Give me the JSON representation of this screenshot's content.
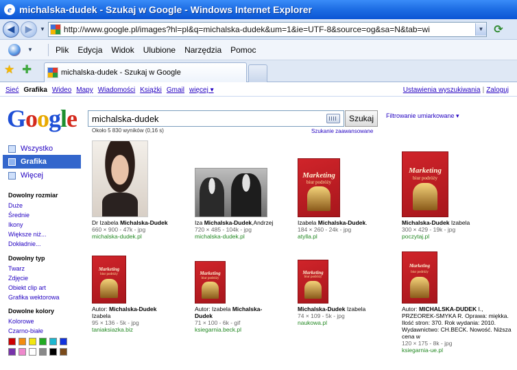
{
  "window": {
    "title": "michalska-dudek - Szukaj w Google - Windows Internet Explorer"
  },
  "address": {
    "url": "http://www.google.pl/images?hl=pl&q=michalska-dudek&um=1&ie=UTF-8&source=og&sa=N&tab=wi"
  },
  "menu": [
    "Plik",
    "Edycja",
    "Widok",
    "Ulubione",
    "Narzędzia",
    "Pomoc"
  ],
  "tab": {
    "label": "michalska-dudek - Szukaj w Google"
  },
  "gbar": {
    "links": [
      "Sieć",
      "Grafika",
      "Wideo",
      "Mapy",
      "Wiadomości",
      "Książki",
      "Gmail",
      "więcej ▾"
    ],
    "settings": "Ustawienia wyszukiwania",
    "separator": "|",
    "login": "Zaloguj"
  },
  "logo": {
    "letters": [
      "G",
      "o",
      "o",
      "g",
      "l",
      "e"
    ]
  },
  "search": {
    "query": "michalska-dudek",
    "button": "Szukaj",
    "safesearch": "Filtrowanie umiarkowane ▾",
    "results": "Około 5 830 wyników  (0,16 s)",
    "advanced": "Szukanie zaawansowane"
  },
  "sidebar": {
    "types": [
      "Wszystko",
      "Grafika",
      "Więcej"
    ],
    "size_head": "Dowolny rozmiar",
    "sizes": [
      "Duże",
      "Średnie",
      "Ikony",
      "Większe niż...",
      "Dokładnie..."
    ],
    "type_head": "Dowolny typ",
    "kinds": [
      "Twarz",
      "Zdjęcie",
      "Obiekt clip art",
      "Grafika wektorowa"
    ],
    "color_head": "Dowolne kolory",
    "colors": [
      "Kolorowe",
      "Czarno-białe"
    ],
    "swatches": [
      "#cc0000",
      "#f28c0f",
      "#f2e610",
      "#22aa22",
      "#1db7d0",
      "#1133dd",
      "#7733aa",
      "#ee88cc",
      "#ffffff",
      "#888888",
      "#000000",
      "#7a4a1a"
    ]
  },
  "results": [
    {
      "cap_pre": "Dr Izabela ",
      "cap_bold": "Michalska-Dudek",
      "cap_post": "",
      "meta": "660 × 900 - 47k - jpg",
      "src": "michalska-dudek.pl"
    },
    {
      "cap_pre": "Iza ",
      "cap_bold": "Michalska-Dudek",
      "cap_post": ",Andrzej",
      "meta": "720 × 485 - 104k - jpg",
      "src": "michalska-dudek.pl"
    },
    {
      "cap_pre": "Izabela ",
      "cap_bold": "Michalska-Dudek",
      "cap_post": ".",
      "meta": "184 × 260 - 24k - jpg",
      "src": "atylla.pl"
    },
    {
      "cap_pre": "",
      "cap_bold": "Michalska-Dudek",
      "cap_post": " Izabela",
      "meta": "300 × 429 - 19k - jpg",
      "src": "poczytaj.pl"
    },
    {
      "cap_pre": "Autor: ",
      "cap_bold": "Michalska-Dudek",
      "cap_post": " Izabela",
      "meta": "95 × 136 - 5k - jpg",
      "src": "taniaksiazka.biz"
    },
    {
      "cap_pre": "Autor: Izabela ",
      "cap_bold": "Michalska-Dudek",
      "cap_post": "",
      "meta": "71 × 100 - 6k - gif",
      "src": "ksiegarnia.beck.pl"
    },
    {
      "cap_pre": "",
      "cap_bold": "Michalska-Dudek",
      "cap_post": " Izabela",
      "meta": "74 × 109 - 5k - jpg",
      "src": "naukowa.pl"
    },
    {
      "cap_pre": "Autor: ",
      "cap_bold": "MICHALSKA-DUDEK",
      "cap_post": " I., PRZEOREK-SMYKA R. Oprawa: miękka. Ilość stron: 370. Rok wydania: 2010. Wydawnictwo: CH.BECK. Nowość. Niższa cena w",
      "meta": "120 × 175 - 8k - jpg",
      "src": "ksiegarnia-ue.pl"
    }
  ],
  "book": {
    "title": "Marketing",
    "subtitle": "biur podróży"
  }
}
